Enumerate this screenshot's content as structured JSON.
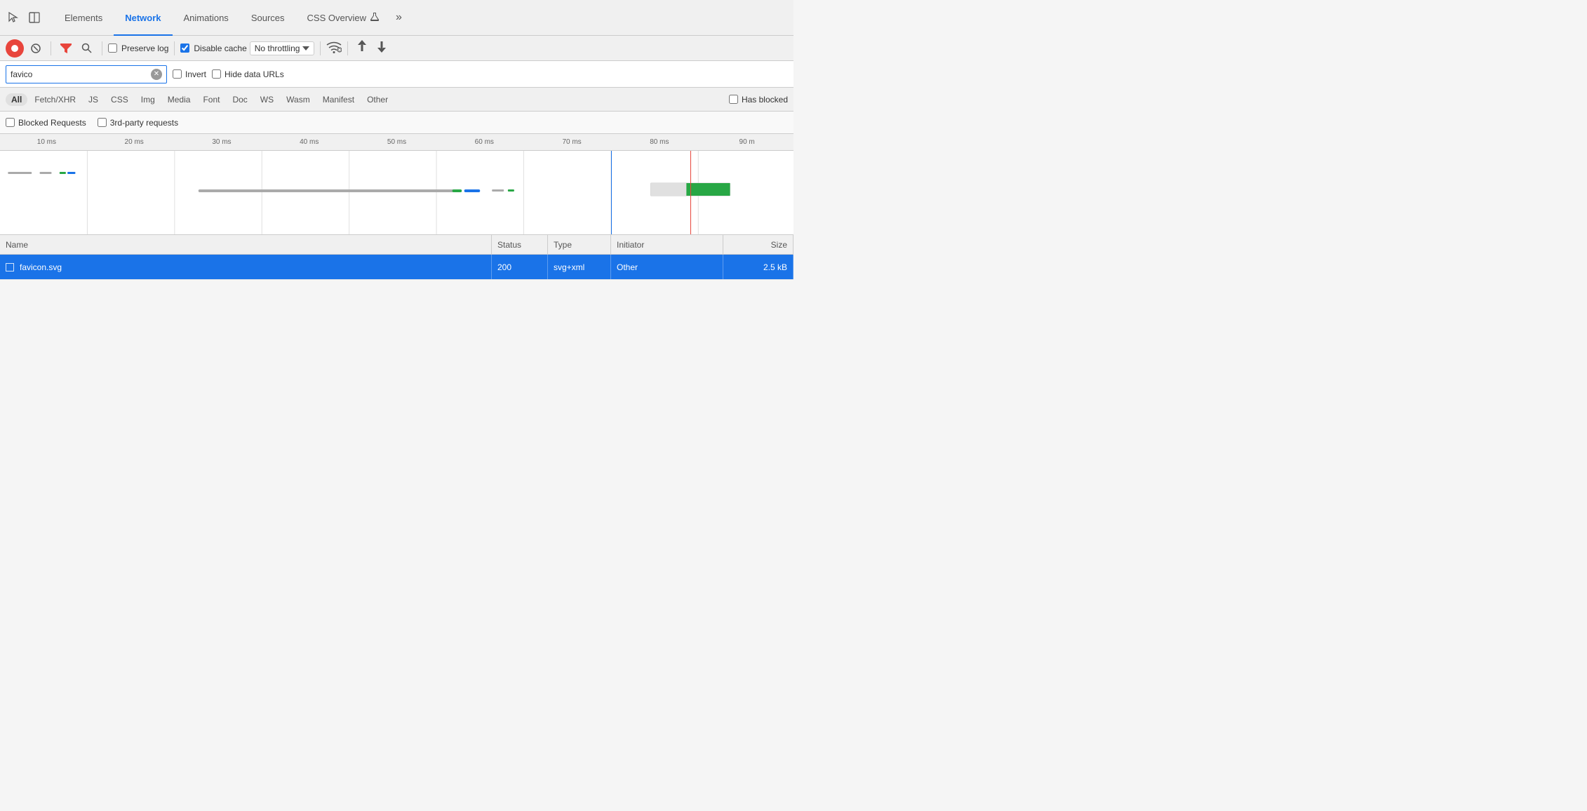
{
  "tabs": [
    {
      "id": "elements",
      "label": "Elements",
      "active": false
    },
    {
      "id": "network",
      "label": "Network",
      "active": true
    },
    {
      "id": "animations",
      "label": "Animations",
      "active": false
    },
    {
      "id": "sources",
      "label": "Sources",
      "active": false
    },
    {
      "id": "css-overview",
      "label": "CSS Overview",
      "active": false
    }
  ],
  "toolbar": {
    "record_title": "Stop recording network log",
    "clear_title": "Clear",
    "filter_title": "Filter",
    "search_title": "Search",
    "preserve_log_label": "Preserve log",
    "preserve_log_checked": false,
    "disable_cache_label": "Disable cache",
    "disable_cache_checked": true,
    "no_throttling_label": "No throttling",
    "upload_title": "Upload HAR",
    "download_title": "Import HAR"
  },
  "filter": {
    "search_value": "favico",
    "search_placeholder": "Filter",
    "invert_label": "Invert",
    "invert_checked": false,
    "hide_data_urls_label": "Hide data URLs",
    "hide_data_urls_checked": false
  },
  "resource_types": [
    {
      "id": "all",
      "label": "All",
      "active": true
    },
    {
      "id": "fetch-xhr",
      "label": "Fetch/XHR",
      "active": false
    },
    {
      "id": "js",
      "label": "JS",
      "active": false
    },
    {
      "id": "css",
      "label": "CSS",
      "active": false
    },
    {
      "id": "img",
      "label": "Img",
      "active": false
    },
    {
      "id": "media",
      "label": "Media",
      "active": false
    },
    {
      "id": "font",
      "label": "Font",
      "active": false
    },
    {
      "id": "doc",
      "label": "Doc",
      "active": false
    },
    {
      "id": "ws",
      "label": "WS",
      "active": false
    },
    {
      "id": "wasm",
      "label": "Wasm",
      "active": false
    },
    {
      "id": "manifest",
      "label": "Manifest",
      "active": false
    },
    {
      "id": "other",
      "label": "Other",
      "active": false
    }
  ],
  "has_blocked_label": "Has blocked",
  "blocked_requests_label": "Blocked Requests",
  "third_party_label": "3rd-party requests",
  "timeline": {
    "labels": [
      "10 ms",
      "20 ms",
      "30 ms",
      "40 ms",
      "50 ms",
      "60 ms",
      "70 ms",
      "80 ms",
      "90 m"
    ]
  },
  "table": {
    "columns": [
      {
        "id": "name",
        "label": "Name"
      },
      {
        "id": "status",
        "label": "Status"
      },
      {
        "id": "type",
        "label": "Type"
      },
      {
        "id": "initiator",
        "label": "Initiator"
      },
      {
        "id": "size",
        "label": "Size"
      }
    ],
    "rows": [
      {
        "name": "favicon.svg",
        "status": "200",
        "type": "svg+xml",
        "initiator": "Other",
        "size": "2.5 kB",
        "selected": true
      }
    ]
  }
}
